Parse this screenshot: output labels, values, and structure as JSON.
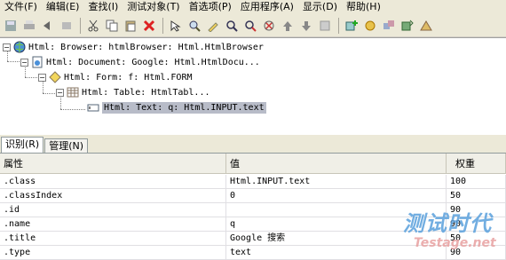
{
  "menubar": {
    "items": [
      "文件(F)",
      "编辑(E)",
      "查找(I)",
      "测试对象(T)",
      "首选项(P)",
      "应用程序(A)",
      "显示(D)",
      "帮助(H)"
    ]
  },
  "tree": {
    "nodes": [
      {
        "label": "Html: Browser: htmlBrowser: Html.HtmlBrowser",
        "expander": "−",
        "icon": "globe-icon"
      },
      {
        "label": "Html: Document: Google: Html.HtmlDocu...",
        "expander": "−",
        "icon": "document-icon"
      },
      {
        "label": "Html: Form: f: Html.FORM",
        "expander": "−",
        "icon": "form-icon"
      },
      {
        "label": "Html: Table: HtmlTabl...",
        "expander": "−",
        "icon": "table-icon"
      },
      {
        "label": "Html: Text: q: Html.INPUT.text",
        "expander": "",
        "icon": "textbox-icon"
      }
    ]
  },
  "tabs": {
    "identify": "识别(R)",
    "manage": "管理(N)"
  },
  "grid": {
    "headers": {
      "property": "属性",
      "value": "值",
      "weight": "权重"
    },
    "rows": [
      {
        "property": ".class",
        "value": "Html.INPUT.text",
        "weight": "100"
      },
      {
        "property": ".classIndex",
        "value": "0",
        "weight": "50"
      },
      {
        "property": ".id",
        "value": "",
        "weight": "90"
      },
      {
        "property": ".name",
        "value": "q",
        "weight": "90"
      },
      {
        "property": ".title",
        "value": "Google 搜索",
        "weight": "50"
      },
      {
        "property": ".type",
        "value": "text",
        "weight": "90"
      }
    ]
  },
  "watermark": {
    "top": "测试时代",
    "bottom": "Testage.net"
  }
}
